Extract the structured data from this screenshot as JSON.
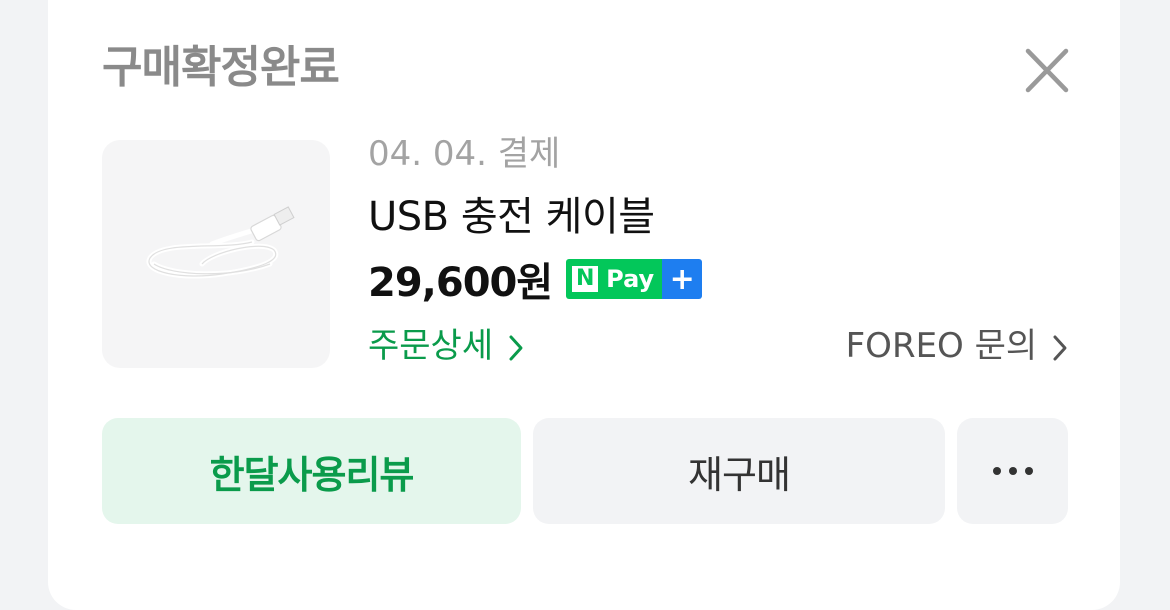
{
  "modal": {
    "title": "구매확정완료",
    "close_icon": "close-icon"
  },
  "order": {
    "date": "04. 04. 결제",
    "product_name": "USB 충전 케이블",
    "price": "29,600원",
    "npay_badge": {
      "n_label": "N",
      "pay_label": "Pay",
      "plus_label": "+"
    },
    "detail_link": "주문상세",
    "inquiry_link": "FOREO 문의"
  },
  "actions": {
    "review_label": "한달사용리뷰",
    "rebuy_label": "재구매",
    "more_icon": "more-dots-icon"
  },
  "colors": {
    "accent_green": "#0a9b4b",
    "review_bg": "#e4f6ec",
    "npay_green": "#03c75a",
    "npay_blue": "#1e7ef0"
  }
}
